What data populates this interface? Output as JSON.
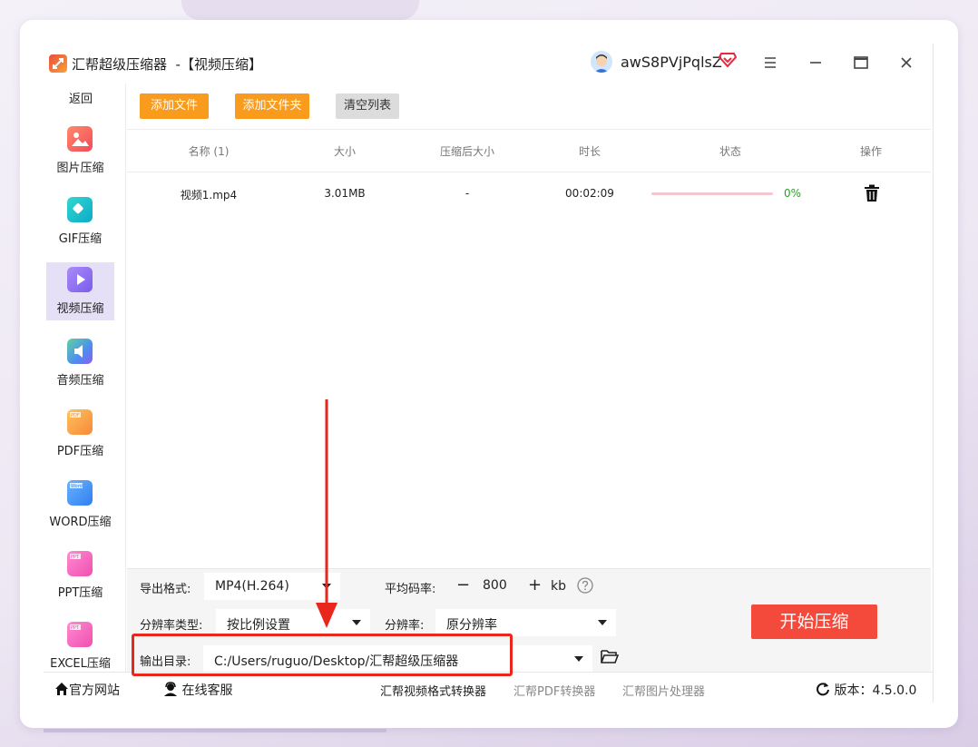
{
  "app": {
    "title": "汇帮超级压缩器  -【视频压缩】",
    "username": "awS8PVjPqlsZ"
  },
  "sidebar": {
    "back_label": "返回",
    "items": [
      {
        "label": "图片压缩",
        "icon": "image-icon",
        "color": "#f46d55"
      },
      {
        "label": "GIF压缩",
        "icon": "gif-icon",
        "color": "#16c6c7"
      },
      {
        "label": "视频压缩",
        "icon": "video-icon",
        "color": "#8c6cf0",
        "active": true
      },
      {
        "label": "音频压缩",
        "icon": "audio-icon",
        "color": "#3fa1ef"
      },
      {
        "label": "PDF压缩",
        "icon": "pdf-icon",
        "color": "#f9a23a"
      },
      {
        "label": "WORD压缩",
        "icon": "word-icon",
        "color": "#3b8bf0"
      },
      {
        "label": "PPT压缩",
        "icon": "ppt-icon",
        "color": "#f55bb2"
      },
      {
        "label": "EXCEL压缩",
        "icon": "excel-icon",
        "color": "#f55bb2"
      }
    ]
  },
  "toolbar": {
    "add_file": "添加文件",
    "add_folder": "添加文件夹",
    "clear_list": "清空列表"
  },
  "table": {
    "headers": [
      "名称 (1)",
      "大小",
      "压缩后大小",
      "时长",
      "状态",
      "操作"
    ],
    "rows": [
      {
        "name": "视频1.mp4",
        "size": "3.01MB",
        "compressed": "-",
        "duration": "00:02:09",
        "progress": 0,
        "progress_label": "0%"
      }
    ]
  },
  "settings": {
    "format_label": "导出格式:",
    "format_value": "MP4(H.264)",
    "bitrate_label": "平均码率:",
    "bitrate_minus": "−",
    "bitrate_value": "800",
    "bitrate_plus": "+",
    "bitrate_unit": "kb",
    "res_type_label": "分辨率类型:",
    "res_type_value": "按比例设置",
    "res_label": "分辨率:",
    "res_value": "原分辨率",
    "output_label": "输出目录:",
    "output_value": "C:/Users/ruguo/Desktop/汇帮超级压缩器",
    "start_button": "开始压缩"
  },
  "footer": {
    "website": "官方网站",
    "support": "在线客服",
    "link1": "汇帮视频格式转换器",
    "link2": "汇帮PDF转换器",
    "link3": "汇帮图片处理器",
    "version": "版本：4.5.0.0"
  },
  "colors": {
    "accent_orange": "#f99b1c",
    "start_red": "#f34a3c",
    "highlight_red": "#e8281c",
    "progress_pink": "#e64b6a",
    "percent_green": "#2aa02a"
  }
}
